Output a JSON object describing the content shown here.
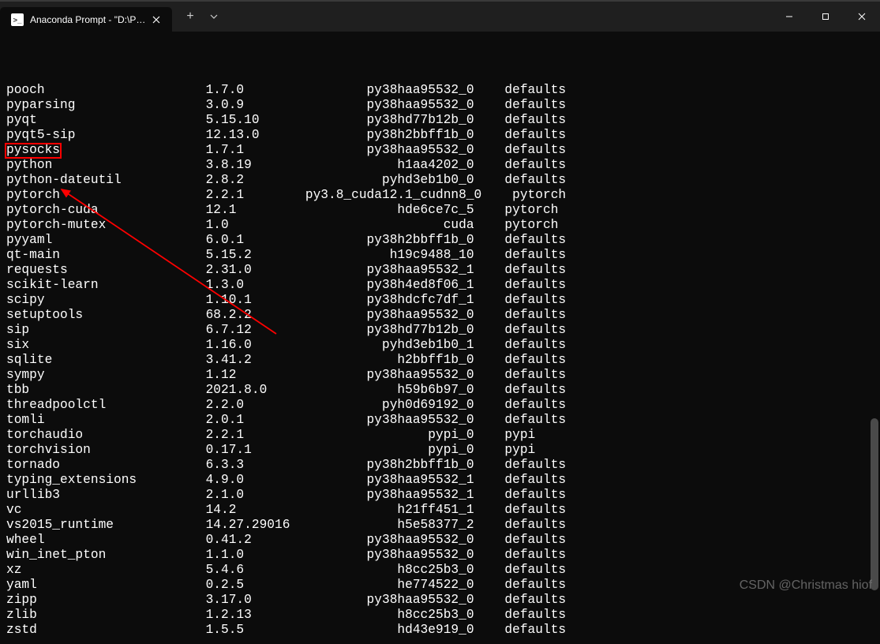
{
  "titlebar": {
    "tab_title": "Anaconda Prompt - \"D:\\Prog…",
    "tab_icon_label": "⧉"
  },
  "packages": [
    {
      "name": "pooch",
      "version": "1.7.0",
      "build": "py38haa95532_0",
      "channel": "defaults"
    },
    {
      "name": "pyparsing",
      "version": "3.0.9",
      "build": "py38haa95532_0",
      "channel": "defaults"
    },
    {
      "name": "pyqt",
      "version": "5.15.10",
      "build": "py38hd77b12b_0",
      "channel": "defaults"
    },
    {
      "name": "pyqt5-sip",
      "version": "12.13.0",
      "build": "py38h2bbff1b_0",
      "channel": "defaults"
    },
    {
      "name": "pysocks",
      "version": "1.7.1",
      "build": "py38haa95532_0",
      "channel": "defaults"
    },
    {
      "name": "python",
      "version": "3.8.19",
      "build": "h1aa4202_0",
      "channel": "defaults"
    },
    {
      "name": "python-dateutil",
      "version": "2.8.2",
      "build": "pyhd3eb1b0_0",
      "channel": "defaults"
    },
    {
      "name": "pytorch",
      "version": "2.2.1",
      "build": "py3.8_cuda12.1_cudnn8_0",
      "channel": "pytorch"
    },
    {
      "name": "pytorch-cuda",
      "version": "12.1",
      "build": "hde6ce7c_5",
      "channel": "pytorch"
    },
    {
      "name": "pytorch-mutex",
      "version": "1.0",
      "build": "cuda",
      "channel": "pytorch"
    },
    {
      "name": "pyyaml",
      "version": "6.0.1",
      "build": "py38h2bbff1b_0",
      "channel": "defaults"
    },
    {
      "name": "qt-main",
      "version": "5.15.2",
      "build": "h19c9488_10",
      "channel": "defaults"
    },
    {
      "name": "requests",
      "version": "2.31.0",
      "build": "py38haa95532_1",
      "channel": "defaults"
    },
    {
      "name": "scikit-learn",
      "version": "1.3.0",
      "build": "py38h4ed8f06_1",
      "channel": "defaults"
    },
    {
      "name": "scipy",
      "version": "1.10.1",
      "build": "py38hdcfc7df_1",
      "channel": "defaults"
    },
    {
      "name": "setuptools",
      "version": "68.2.2",
      "build": "py38haa95532_0",
      "channel": "defaults"
    },
    {
      "name": "sip",
      "version": "6.7.12",
      "build": "py38hd77b12b_0",
      "channel": "defaults"
    },
    {
      "name": "six",
      "version": "1.16.0",
      "build": "pyhd3eb1b0_1",
      "channel": "defaults"
    },
    {
      "name": "sqlite",
      "version": "3.41.2",
      "build": "h2bbff1b_0",
      "channel": "defaults"
    },
    {
      "name": "sympy",
      "version": "1.12",
      "build": "py38haa95532_0",
      "channel": "defaults"
    },
    {
      "name": "tbb",
      "version": "2021.8.0",
      "build": "h59b6b97_0",
      "channel": "defaults"
    },
    {
      "name": "threadpoolctl",
      "version": "2.2.0",
      "build": "pyh0d69192_0",
      "channel": "defaults"
    },
    {
      "name": "tomli",
      "version": "2.0.1",
      "build": "py38haa95532_0",
      "channel": "defaults"
    },
    {
      "name": "torchaudio",
      "version": "2.2.1",
      "build": "pypi_0",
      "channel": "pypi"
    },
    {
      "name": "torchvision",
      "version": "0.17.1",
      "build": "pypi_0",
      "channel": "pypi"
    },
    {
      "name": "tornado",
      "version": "6.3.3",
      "build": "py38h2bbff1b_0",
      "channel": "defaults"
    },
    {
      "name": "typing_extensions",
      "version": "4.9.0",
      "build": "py38haa95532_1",
      "channel": "defaults"
    },
    {
      "name": "urllib3",
      "version": "2.1.0",
      "build": "py38haa95532_1",
      "channel": "defaults"
    },
    {
      "name": "vc",
      "version": "14.2",
      "build": "h21ff451_1",
      "channel": "defaults"
    },
    {
      "name": "vs2015_runtime",
      "version": "14.27.29016",
      "build": "h5e58377_2",
      "channel": "defaults"
    },
    {
      "name": "wheel",
      "version": "0.41.2",
      "build": "py38haa95532_0",
      "channel": "defaults"
    },
    {
      "name": "win_inet_pton",
      "version": "1.1.0",
      "build": "py38haa95532_0",
      "channel": "defaults"
    },
    {
      "name": "xz",
      "version": "5.4.6",
      "build": "h8cc25b3_0",
      "channel": "defaults"
    },
    {
      "name": "yaml",
      "version": "0.2.5",
      "build": "he774522_0",
      "channel": "defaults"
    },
    {
      "name": "zipp",
      "version": "3.17.0",
      "build": "py38haa95532_0",
      "channel": "defaults"
    },
    {
      "name": "zlib",
      "version": "1.2.13",
      "build": "h8cc25b3_0",
      "channel": "defaults"
    },
    {
      "name": "zstd",
      "version": "1.5.5",
      "build": "hd43e919_0",
      "channel": "defaults"
    }
  ],
  "columns": {
    "name_width": 26,
    "version_width": 17,
    "build_width": 22,
    "channel_pad": 4
  },
  "watermark": "CSDN @Christmas hiof"
}
